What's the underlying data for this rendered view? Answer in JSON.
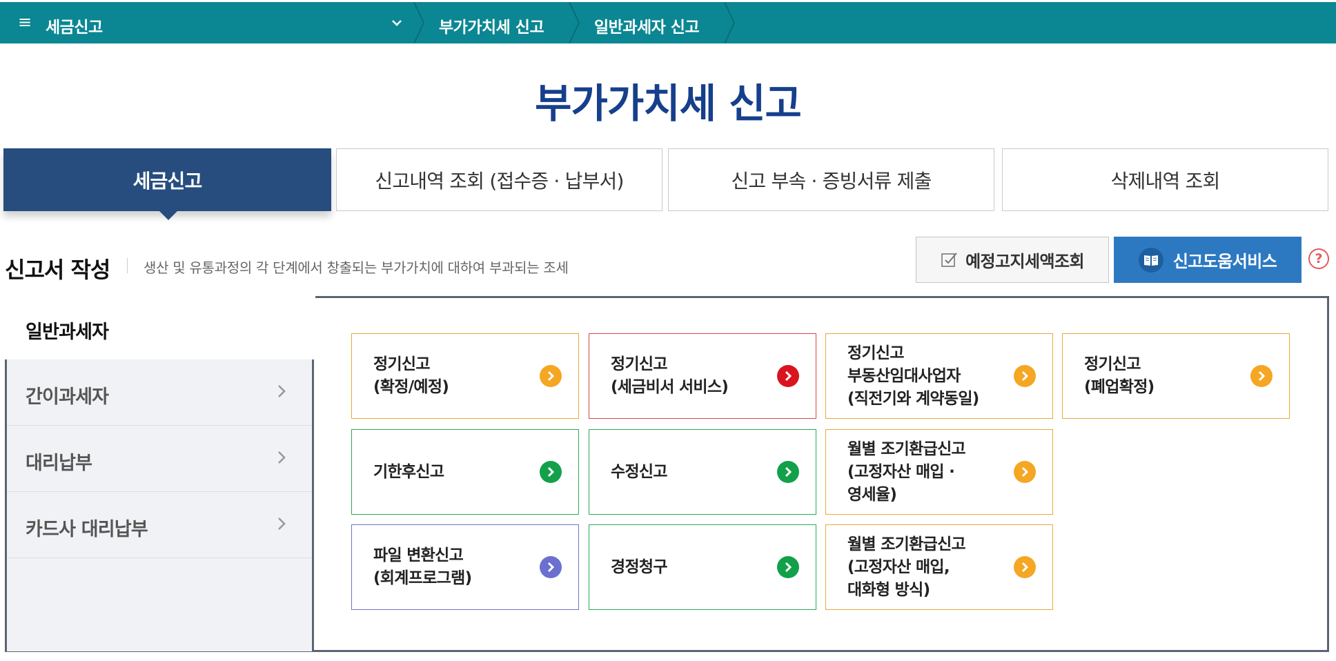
{
  "colors": {
    "topbar": "#0b8793",
    "title": "#163f8c",
    "active_tab": "#264d7e",
    "help_button": "#2c79c2",
    "orange": "#f5a623",
    "red": "#d9141e",
    "green": "#13a04b",
    "blue": "#6a6fd0"
  },
  "topbar": {
    "menu_icon": "hamburger-icon",
    "root_label": "세금신고",
    "crumbs": [
      "부가가치세 신고",
      "일반과세자 신고"
    ]
  },
  "page_title": "부가가치세 신고",
  "tabs": [
    {
      "label": "세금신고",
      "active": true
    },
    {
      "label": "신고내역 조회 (접수증 · 납부서)",
      "active": false
    },
    {
      "label": "신고 부속 · 증빙서류 제출",
      "active": false
    },
    {
      "label": "삭제내역 조회",
      "active": false
    }
  ],
  "section": {
    "title": "신고서 작성",
    "description": "생산 및 유통과정의 각 단계에서 창출되는 부가가치에 대하여 부과되는 조세",
    "estimate_button": "예정고지세액조회",
    "help_button": "신고도움서비스",
    "help_symbol": "?"
  },
  "sidebar": {
    "active": "일반과세자",
    "items": [
      "간이과세자",
      "대리납부",
      "카드사 대리납부"
    ]
  },
  "cards": [
    {
      "lines": [
        "정기신고",
        "(확정/예정)"
      ],
      "color": "orange"
    },
    {
      "lines": [
        "정기신고",
        "(세금비서 서비스)"
      ],
      "color": "red"
    },
    {
      "lines": [
        "정기신고",
        "부동산임대사업자",
        "(직전기와 계약동일)"
      ],
      "color": "orange"
    },
    {
      "lines": [
        "정기신고",
        "(폐업확정)"
      ],
      "color": "orange"
    },
    {
      "lines": [
        "기한후신고"
      ],
      "color": "green"
    },
    {
      "lines": [
        "수정신고"
      ],
      "color": "green"
    },
    {
      "lines": [
        "월별 조기환급신고",
        "(고정자산 매입 ·",
        "영세율)"
      ],
      "color": "orange"
    },
    {
      "lines": [
        "파일 변환신고",
        "(회계프로그램)"
      ],
      "color": "blue"
    },
    {
      "lines": [
        "경정청구"
      ],
      "color": "green"
    },
    {
      "lines": [
        "월별 조기환급신고",
        "(고정자산 매입,",
        "대화형 방식)"
      ],
      "color": "orange"
    }
  ]
}
